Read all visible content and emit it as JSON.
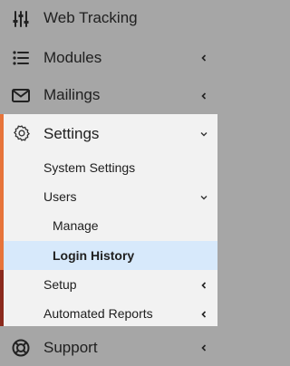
{
  "nav": {
    "web_tracking": "Web Tracking",
    "modules": "Modules",
    "mailings": "Mailings",
    "settings": "Settings",
    "settings_children": {
      "system_settings": "System Settings",
      "users": "Users",
      "manage": "Manage",
      "login_history": "Login History",
      "setup": "Setup",
      "automated_reports": "Automated Reports"
    },
    "support": "Support"
  },
  "icons": {
    "web_tracking": "sliders-icon",
    "modules": "list-icon",
    "mailings": "envelope-icon",
    "settings": "gear-icon",
    "support": "lifebuoy-icon"
  },
  "colors": {
    "overlay_gray": "#a6a6a6",
    "panel": "#f2f2f2",
    "accent_orange": "#e7743a",
    "accent_red": "#8b2a1d",
    "active_bg": "#d7e9fb"
  }
}
